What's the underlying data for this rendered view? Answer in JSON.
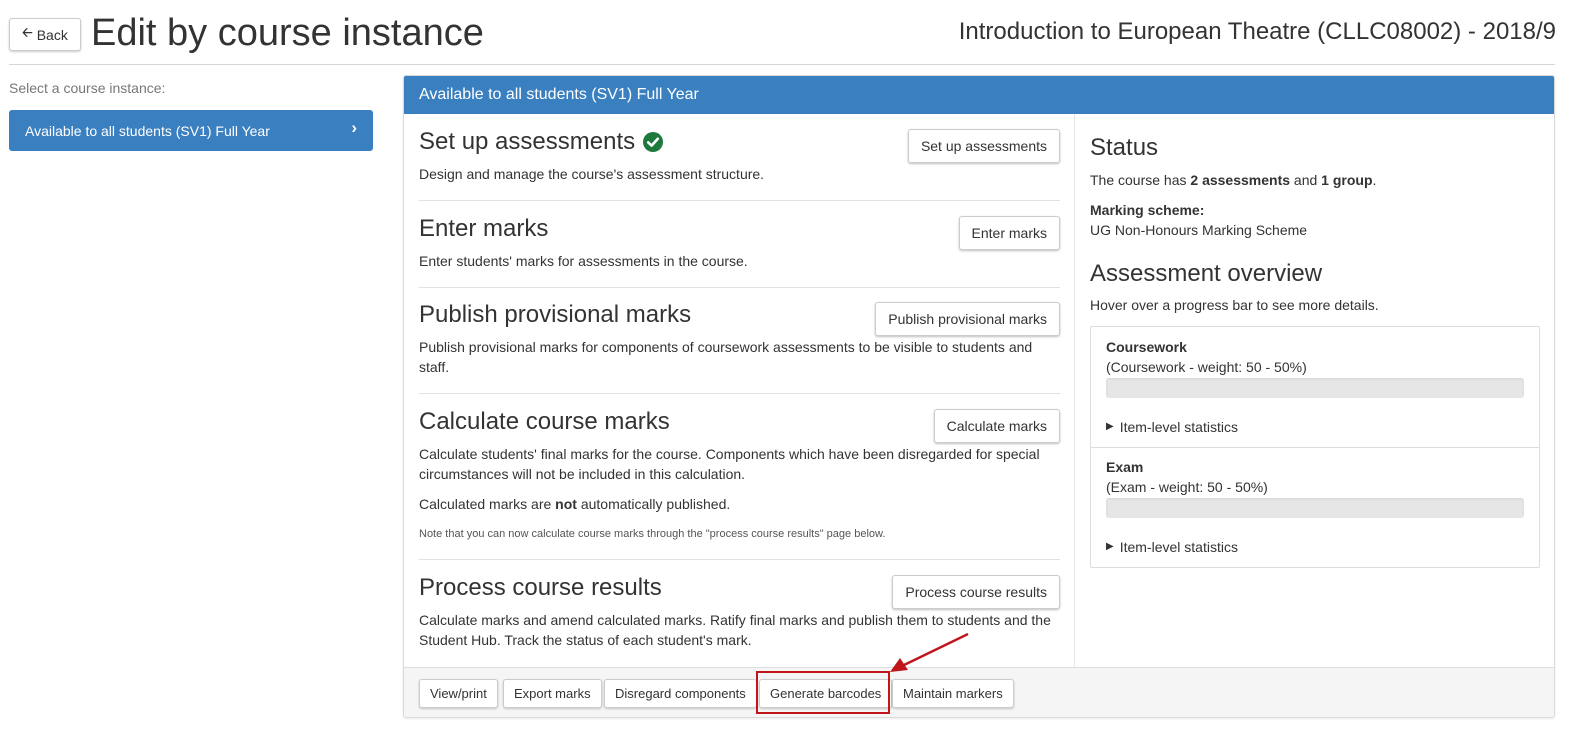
{
  "header": {
    "back_label": "Back",
    "title": "Edit by course instance",
    "course": "Introduction to European Theatre (CLLC08002) - 2018/9"
  },
  "sidebar": {
    "select_label": "Select a course instance:",
    "instances": [
      {
        "label": "Available to all students (SV1) Full Year",
        "active": true
      }
    ]
  },
  "panel": {
    "heading": "Available to all students (SV1) Full Year",
    "sections": {
      "setup": {
        "title": "Set up assessments",
        "description": "Design and manage the course's assessment structure.",
        "button": "Set up assessments",
        "complete": true
      },
      "enter": {
        "title": "Enter marks",
        "description": "Enter students' marks for assessments in the course.",
        "button": "Enter marks"
      },
      "publish": {
        "title": "Publish provisional marks",
        "description": "Publish provisional marks for components of coursework assessments to be visible to students and staff.",
        "button": "Publish provisional marks"
      },
      "calculate": {
        "title": "Calculate course marks",
        "description": "Calculate students' final marks for the course. Components which have been disregarded for special circumstances will not be included in this calculation.",
        "note_prefix": "Calculated marks are ",
        "note_bold": "not",
        "note_suffix": " automatically published.",
        "small_note": "Note that you can now calculate course marks through the \"process course results\" page below.",
        "button": "Calculate marks"
      },
      "process": {
        "title": "Process course results",
        "description": "Calculate marks and amend calculated marks. Ratify final marks and publish them to students and the Student Hub. Track the status of each student's mark.",
        "button": "Process course results"
      }
    },
    "status": {
      "title": "Status",
      "summary_prefix": "The course has ",
      "assessments_count": "2 assessments",
      "summary_mid": " and ",
      "groups_count": "1 group",
      "summary_suffix": ".",
      "marking_scheme_label": "Marking scheme:",
      "marking_scheme_value": "UG Non-Honours Marking Scheme"
    },
    "overview": {
      "title": "Assessment overview",
      "hint": "Hover over a progress bar to see more details.",
      "items": [
        {
          "name": "Coursework",
          "detail": "(Coursework - weight: 50 - 50%)",
          "progress": 0,
          "stats_label": "Item-level statistics"
        },
        {
          "name": "Exam",
          "detail": "(Exam - weight: 50 - 50%)",
          "progress": 0,
          "stats_label": "Item-level statistics"
        }
      ]
    },
    "footer": {
      "buttons": [
        "View/print",
        "Export marks",
        "Disregard components",
        "Generate barcodes",
        "Maintain markers"
      ]
    }
  },
  "colors": {
    "primary": "#3a7fc0",
    "success": "#1e7a3c",
    "annotation": "#c0161b"
  }
}
